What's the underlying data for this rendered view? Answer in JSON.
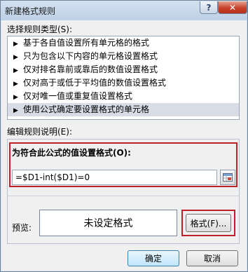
{
  "window": {
    "title": "新建格式规则",
    "help_label": "?",
    "close_label": "✕"
  },
  "rule_type": {
    "label": "选择规则类型(S):",
    "items": [
      "基于各自值设置所有单元格的格式",
      "只为包含以下内容的单元格设置格式",
      "仅对排名靠前或靠后的数值设置格式",
      "仅对高于或低于平均值的数值设置格式",
      "仅对唯一值或重复值设置格式",
      "使用公式确定要设置格式的单元格"
    ],
    "selected_index": 5
  },
  "rule_description": {
    "label": "编辑规则说明(E):",
    "formula_label": "为符合此公式的值设置格式(O):",
    "formula_value": "=$D1-int($D1)=0",
    "preview_label": "预览:",
    "preview_text": "未设定格式",
    "format_button": "格式(F)..."
  },
  "buttons": {
    "ok": "确定",
    "cancel": "取消"
  },
  "colors": {
    "highlight_border": "#c0202a",
    "selected_item": "#d8dde5"
  }
}
